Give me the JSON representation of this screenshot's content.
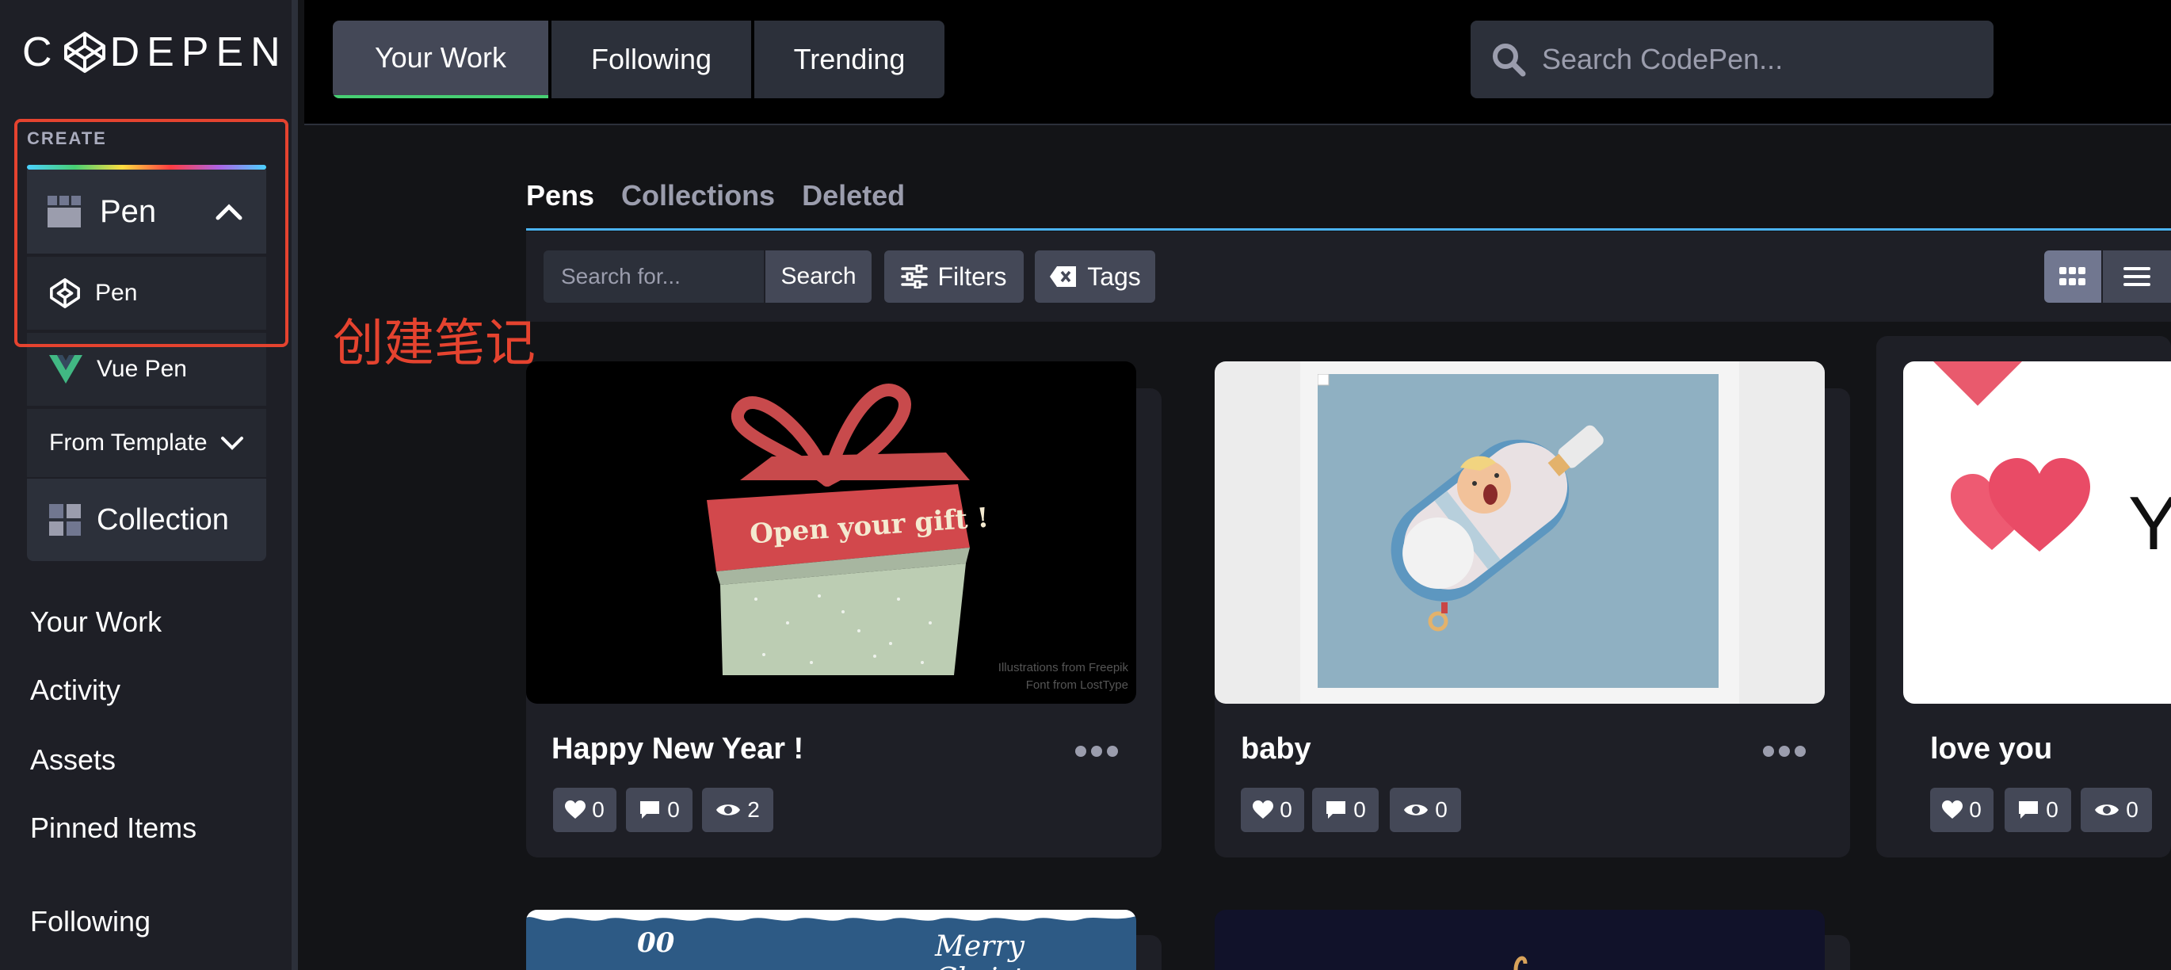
{
  "sidebar": {
    "logo_text_left": "C",
    "logo_text_right": "DEPEN",
    "create_label": "CREATE",
    "pen_label": "Pen",
    "sub_items": [
      "Pen",
      "Vue Pen",
      "From Template"
    ],
    "collection_label": "Collection",
    "nav": [
      "Your Work",
      "Activity",
      "Assets",
      "Pinned Items",
      "Following"
    ]
  },
  "header": {
    "tabs": [
      "Your Work",
      "Following",
      "Trending"
    ],
    "search_placeholder": "Search CodePen..."
  },
  "content": {
    "subtabs": [
      "Pens",
      "Collections",
      "Deleted"
    ],
    "search_placeholder": "Search for...",
    "search_button": "Search",
    "filters_button": "Filters",
    "tags_button": "Tags"
  },
  "annotation_text": "创建笔记",
  "cards": [
    {
      "title": "Happy New Year !",
      "thumb_text": "Open your gift !",
      "credit_1": "Illustrations from Freepik",
      "credit_2": "Font from LostType",
      "likes": "0",
      "comments": "0",
      "views": "2"
    },
    {
      "title": "baby",
      "likes": "0",
      "comments": "0",
      "views": "0"
    },
    {
      "title": "love you",
      "thumb_text": "Y",
      "likes": "0",
      "comments": "0",
      "views": "0"
    }
  ],
  "bottom_cards": [
    {
      "thumb_text_1": "00",
      "thumb_text_2": "Merry Christmas"
    }
  ],
  "colors": {
    "accent_green": "#47cf73",
    "accent_blue": "#4bb3f2",
    "annotation_red": "#e5432f",
    "sidebar_bg": "#1e1f26"
  }
}
